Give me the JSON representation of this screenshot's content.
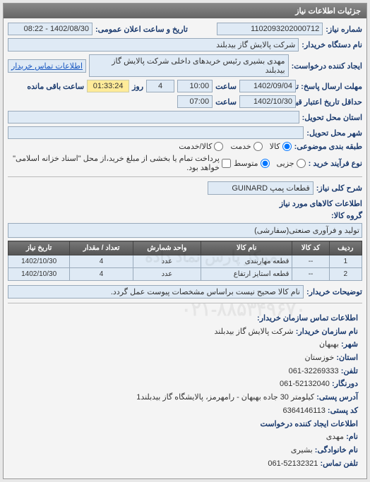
{
  "panel": {
    "title": "جزئیات اطلاعات نیاز"
  },
  "header": {
    "req_no_label": "شماره نیاز:",
    "req_no": "1102093202000712",
    "announce_label": "تاریخ و ساعت اعلان عمومی:",
    "announce": "1402/08/30 - 08:22",
    "buyer_org_label": "نام دستگاه خریدار:",
    "buyer_org": "شرکت پالایش گاز بیدبلند",
    "requester_label": "ایجاد کننده درخواست:",
    "requester": "مهدی بشیری رئیس خریدهای داخلی شرکت پالایش گاز بیدبلند",
    "buyer_contact_link": "اطلاعات تماس خریدار",
    "deadline_label": "مهلت ارسال پاسخ: تا تاریخ:",
    "deadline_date": "1402/09/04",
    "time_label": "ساعت",
    "deadline_time": "10:00",
    "days_label": "روز",
    "days": "4",
    "remaining_label": "ساعت باقی مانده",
    "remaining": "01:33:24",
    "validity_label": "حداقل تاریخ اعتبار قیمت: تا تاریخ:",
    "validity_date": "1402/10/30",
    "validity_time": "07:00",
    "delivery_province_label": "استان محل تحویل:",
    "delivery_city_label": "شهر محل تحویل:",
    "subject_label": "طبقه بندی موضوعی:",
    "subject_options": {
      "goods": "کالا",
      "service": "خدمت",
      "goods_service": "کالا/خدمت"
    },
    "process_label": "نوع فرآیند خرید :",
    "process_options": {
      "small": "جزیی",
      "medium": "متوسط"
    },
    "process_note": "پرداخت تمام یا بخشی از مبلغ خرید،از محل \"اسناد خزانه اسلامی\" خواهد بود."
  },
  "need": {
    "desc_label": "شرح کلی نیاز:",
    "desc": "قطعات پمپ GUINARD",
    "group_title": "اطلاعات کالاهای مورد نیاز",
    "group_label": "گروه کالا:",
    "group": "تولید و فرآوری صنعتی(سفارشی)"
  },
  "table": {
    "headers": {
      "row": "ردیف",
      "code": "کد کالا",
      "name": "نام کالا",
      "unit": "واحد شمارش",
      "qty": "تعداد / مقدار",
      "date": "تاریخ نیاز"
    },
    "rows": [
      {
        "row": "1",
        "code": "--",
        "name": "قطعه مهاربندی",
        "unit": "عدد",
        "qty": "4",
        "date": "1402/10/30"
      },
      {
        "row": "2",
        "code": "--",
        "name": "قطعه استایز ارتفاع",
        "unit": "عدد",
        "qty": "4",
        "date": "1402/10/30"
      }
    ]
  },
  "notes": {
    "label": "توضیحات خریدار:",
    "text": "نام کالا صحیح نیست براساس مشخصات پیوست عمل گردد."
  },
  "contact": {
    "title": "اطلاعات تماس سازمان خریدار:",
    "org_label": "نام سازمان خریدار:",
    "org": "شرکت پالایش گاز بیدبلند",
    "city_label": "شهر:",
    "city": "بهبهان",
    "province_label": "استان:",
    "province": "خوزستان",
    "phone_label": "تلفن:",
    "phone": "32269333-061",
    "fax_label": "دورنگار:",
    "fax": "52132040-061",
    "addr_label": "آدرس پستی:",
    "addr": "کیلومتر 30 جاده بهبهان - رامهرمز، پالایشگاه گاز بیدبلند1",
    "zip_label": "کد پستی:",
    "zip": "6364146113",
    "creator_title": "اطلاعات ایجاد کننده درخواست",
    "fname_label": "نام:",
    "fname": "مهدی",
    "lname_label": "نام خانوادگی:",
    "lname": "بشیری",
    "cphone_label": "تلفن تماس:",
    "cphone": "52132321-061"
  },
  "watermark1": "مرکز پارس نماد داده",
  "watermark2": "۰۲۱-۸۸۵۳۴۹۶۷۰"
}
